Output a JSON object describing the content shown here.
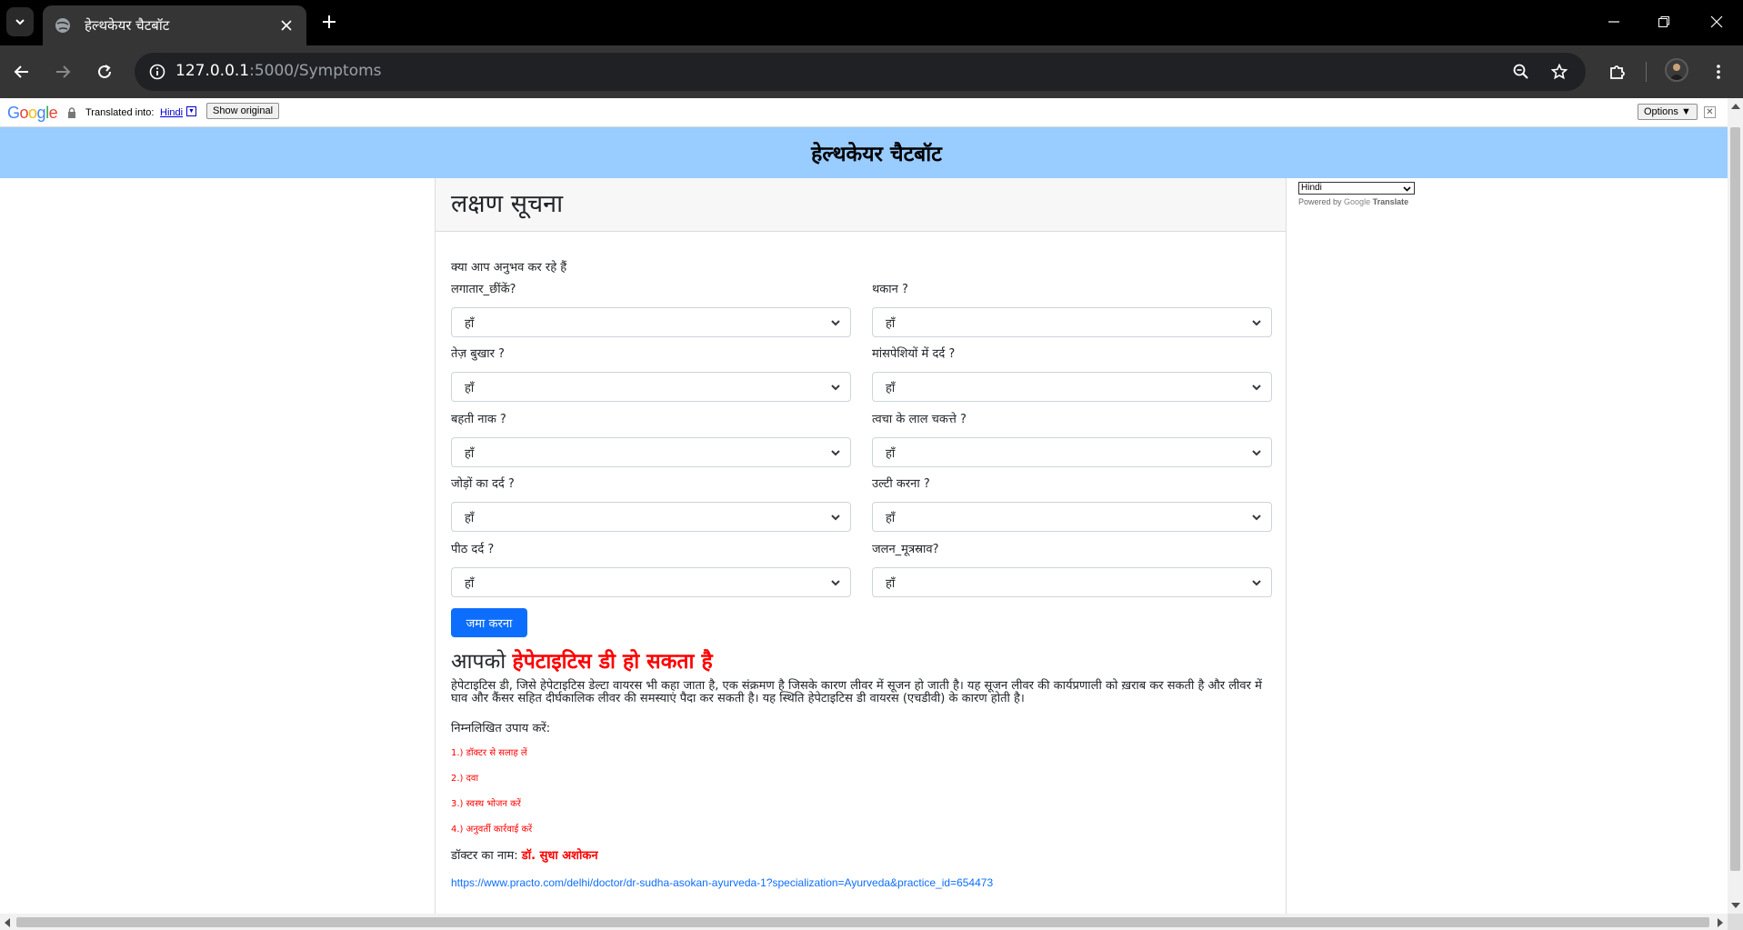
{
  "browser": {
    "tab_title": "हेल्थकेयर चैटबॉट",
    "url_host": "127.0.0.1",
    "url_rest": ":5000/Symptoms"
  },
  "translate_bar": {
    "logo": "Google",
    "translated_into": "Translated into:",
    "language": "Hindi",
    "show_original": "Show original",
    "options": "Options ▼",
    "close": "✕"
  },
  "header": {
    "title": "हेल्थकेयर चैटबॉट"
  },
  "card": {
    "title": "लक्षण सूचना"
  },
  "form": {
    "question": "क्या आप अनुभव कर रहे हैं",
    "fields": [
      {
        "label": "लगातार_छींकें?",
        "value": "हाँ"
      },
      {
        "label": "थकान ?",
        "value": "हाँ"
      },
      {
        "label": "तेज़ बुखार ?",
        "value": "हाँ"
      },
      {
        "label": "मांसपेशियों में दर्द ?",
        "value": "हाँ"
      },
      {
        "label": "बहती नाक ?",
        "value": "हाँ"
      },
      {
        "label": "त्वचा के लाल चकत्ते ?",
        "value": "हाँ"
      },
      {
        "label": "जोड़ों का दर्द ?",
        "value": "हाँ"
      },
      {
        "label": "उल्टी करना ?",
        "value": "हाँ"
      },
      {
        "label": "पीठ दर्द ?",
        "value": "हाँ"
      },
      {
        "label": "जलन_मूत्रस्राव?",
        "value": "हाँ"
      }
    ],
    "submit": "जमा करना"
  },
  "result": {
    "prefix": "आपको",
    "disease": "हेपेटाइटिस डी हो सकता है",
    "description": "हेपेटाइटिस डी, जिसे हेपेटाइटिस डेल्टा वायरस भी कहा जाता है, एक संक्रमण है जिसके कारण लीवर में सूजन हो जाती है। यह सूजन लीवर की कार्यप्रणाली को ख़राब कर सकती है और लीवर में घाव और कैंसर सहित दीर्घकालिक लीवर की समस्याएं पैदा कर सकती है। यह स्थिति हेपेटाइटिस डी वायरस (एचडीवी) के कारण होती है।",
    "remedies_title": "निम्नलिखित उपाय करें:",
    "remedies": [
      "1.) डॉक्टर से सलाह लें",
      "2.) दवा",
      "3.) स्वस्थ भोजन करें",
      "4.) अनुवर्ती कार्रवाई करें"
    ],
    "doctor_label": "डॉक्टर का नाम:",
    "doctor_name": "डॉ. सुधा अशोकन",
    "doctor_link": "https://www.practo.com/delhi/doctor/dr-sudha-asokan-ayurveda-1?specialization=Ayurveda&practice_id=654473"
  },
  "translate_widget": {
    "selected": "Hindi",
    "powered_by": "Powered by",
    "google": "Google",
    "translate": "Translate"
  },
  "colors": {
    "header_bg": "#99ccff",
    "accent_red": "#ff0000",
    "button_blue": "#0d6efd"
  }
}
